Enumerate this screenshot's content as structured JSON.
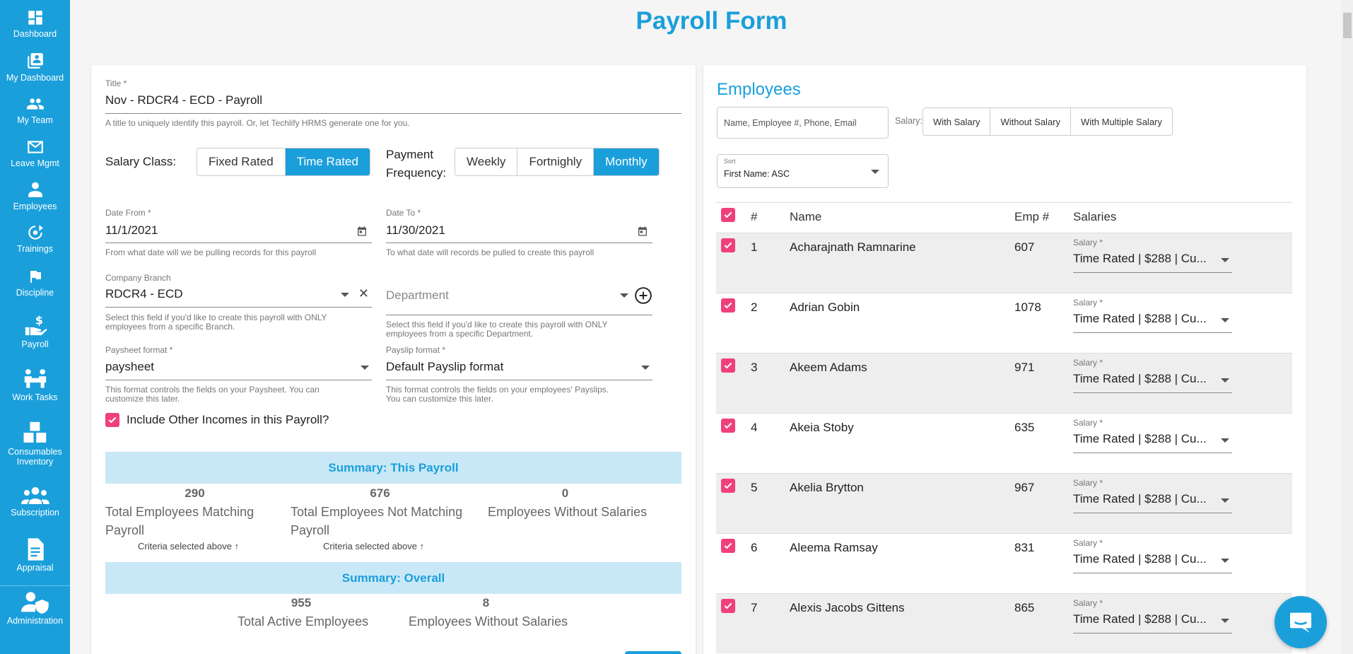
{
  "sidebar": {
    "items": [
      {
        "label": "Dashboard",
        "icon": "dashboard-icon"
      },
      {
        "label": "My Dashboard",
        "icon": "my-dashboard-icon"
      },
      {
        "label": "My Team",
        "icon": "team-icon"
      },
      {
        "label": "Leave Mgmt",
        "icon": "mail-icon"
      },
      {
        "label": "Employees",
        "icon": "employee-icon"
      },
      {
        "label": "Trainings",
        "icon": "trainings-icon"
      },
      {
        "label": "Discipline",
        "icon": "flag-icon"
      },
      {
        "label": "Payroll",
        "icon": "payroll-hand-icon"
      },
      {
        "label": "Work Tasks",
        "icon": "work-tasks-icon"
      },
      {
        "label": "Consumables Inventory",
        "icon": "boxes-icon"
      },
      {
        "label": "Subscription",
        "icon": "group-icon"
      },
      {
        "label": "Appraisal",
        "icon": "document-icon"
      },
      {
        "label": "Administration",
        "icon": "admin-shield-icon"
      }
    ]
  },
  "page": {
    "title": "Payroll Form"
  },
  "form": {
    "title_label": "Title *",
    "title_value": "Nov - RDCR4 - ECD - Payroll",
    "title_helper": "A title to uniquely identify this payroll. Or, let Techlify HRMS generate one for you.",
    "salary_class_label": "Salary Class:",
    "salary_class_options": [
      "Fixed Rated",
      "Time Rated"
    ],
    "salary_class_selected": "Time Rated",
    "payment_freq_label_1": "Payment",
    "payment_freq_label_2": "Frequency:",
    "payment_freq_options": [
      "Weekly",
      "Fortnighly",
      "Monthly"
    ],
    "payment_freq_selected": "Monthly",
    "date_from_label": "Date From *",
    "date_from_value": "11/1/2021",
    "date_from_helper": "From what date will we be pulling records for this payroll",
    "date_to_label": "Date To *",
    "date_to_value": "11/30/2021",
    "date_to_helper": "To what date will records be pulled to create this payroll",
    "branch_label": "Company Branch",
    "branch_value": "RDCR4 - ECD",
    "branch_helper_1": "Select this field if you'd like to create this payroll with ONLY",
    "branch_helper_2": "employees from a specific Branch.",
    "department_placeholder": "Department",
    "department_helper_1": "Select this field if you'd like to create this payroll with ONLY",
    "department_helper_2": "employees from a specific Department.",
    "paysheet_label": "Paysheet format *",
    "paysheet_value": "paysheet",
    "paysheet_helper_1": "This format controls the fields on your Paysheet. You can",
    "paysheet_helper_2": "customize this later.",
    "payslip_label": "Payslip format *",
    "payslip_value": "Default Payslip format",
    "payslip_helper_1": "This format controls the fields on your employees' Payslips.",
    "payslip_helper_2": "You can customize this later.",
    "include_other_incomes": "Include Other Incomes in this Payroll?"
  },
  "summary": {
    "this_payroll_title": "Summary: This Payroll",
    "matching_count": "290",
    "matching_label_1": "Total Employees Matching",
    "matching_label_2": "Payroll",
    "not_matching_count": "676",
    "not_matching_label_1": "Total Employees Not Matching",
    "not_matching_label_2": "Payroll",
    "without_salaries_count": "0",
    "without_salaries_label": "Employees Without Salaries",
    "criteria_text": "Criteria selected above",
    "overall_title": "Summary: Overall",
    "total_active_count": "955",
    "total_active_label": "Total Active Employees",
    "overall_without_count": "8",
    "overall_without_label": "Employees Without Salaries"
  },
  "employees": {
    "title": "Employees",
    "search_placeholder": "Name, Employee #, Phone, Email",
    "salary_filter_label": "Salary:",
    "salary_filters": [
      "With Salary",
      "Without Salary",
      "With Multiple Salary"
    ],
    "sort_label": "Sort",
    "sort_value": "First Name: ASC",
    "columns": [
      "#",
      "Name",
      "Emp #",
      "Salaries"
    ],
    "salary_field_label": "Salary *",
    "rows": [
      {
        "num": "1",
        "name": "Acharajnath Ramnarine",
        "emp": "607",
        "salary": "Time Rated | $288 | Cu..."
      },
      {
        "num": "2",
        "name": "Adrian Gobin",
        "emp": "1078",
        "salary": "Time Rated | $288 | Cu..."
      },
      {
        "num": "3",
        "name": "Akeem Adams",
        "emp": "971",
        "salary": "Time Rated | $288 | Cu..."
      },
      {
        "num": "4",
        "name": "Akeia Stoby",
        "emp": "635",
        "salary": "Time Rated | $288 | Cu..."
      },
      {
        "num": "5",
        "name": "Akelia Brytton",
        "emp": "967",
        "salary": "Time Rated | $288 | Cu..."
      },
      {
        "num": "6",
        "name": "Aleema Ramsay",
        "emp": "831",
        "salary": "Time Rated | $288 | Cu..."
      },
      {
        "num": "7",
        "name": "Alexis Jacobs Gittens",
        "emp": "865",
        "salary": "Time Rated | $288 | Cu..."
      }
    ]
  },
  "colors": {
    "accent": "#1a9fdb",
    "checkbox": "#f0407c",
    "summary_bg": "#c9e8f7"
  }
}
